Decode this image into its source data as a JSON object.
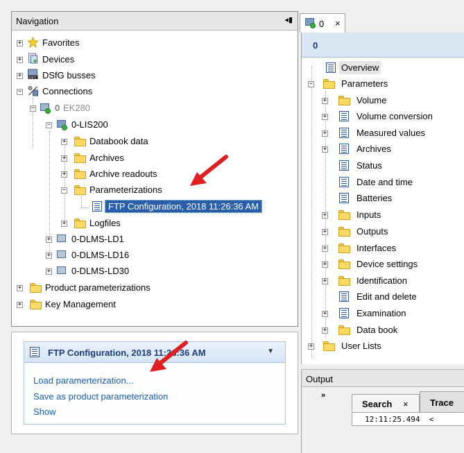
{
  "navigation": {
    "title": "Navigation",
    "pin_icon": "◂▮",
    "tree": {
      "favorites": "Favorites",
      "devices": "Devices",
      "dsfg_busses": "DSfG busses",
      "connections": "Connections",
      "conn_id": "0",
      "conn_device": "EK280",
      "lis200": "0-LIS200",
      "databook": "Databook data",
      "archives": "Archives",
      "archive_readouts": "Archive readouts",
      "parameterizations": "Parameterizations",
      "ftp_config": "FTP Configuration, 2018 11:26:36 AM",
      "logfiles": "Logfiles",
      "dlms_ld1": "0-DLMS-LD1",
      "dlms_ld16": "0-DLMS-LD16",
      "dlms_ld30": "0-DLMS-LD30",
      "product_param": "Product parameterizations",
      "key_mgmt": "Key Management"
    }
  },
  "task_panel": {
    "title": "FTP Configuration, 2018 11:26:36 AM",
    "links": [
      "Load paramerterization...",
      "Save as product parameterization",
      "Show"
    ]
  },
  "right_panel": {
    "tab_label": "0",
    "tab_close": "×",
    "header_label": "0",
    "tree": {
      "overview": "Overview",
      "parameters": "Parameters",
      "volume": "Volume",
      "volume_conversion": "Volume conversion",
      "measured_values": "Measured values",
      "archives": "Archives",
      "status": "Status",
      "date_time": "Date and time",
      "batteries": "Batteries",
      "inputs": "Inputs",
      "outputs": "Outputs",
      "interfaces": "Interfaces",
      "device_settings": "Device settings",
      "identification": "Identification",
      "edit_delete": "Edit and delete",
      "examination": "Examination",
      "data_book": "Data book",
      "user_lists": "User Lists"
    }
  },
  "output": {
    "title": "Output",
    "more": "»",
    "tabs": [
      {
        "label": "Search",
        "close": "×"
      },
      {
        "label": "Trace"
      }
    ],
    "log_line": "12:11:25.494  <"
  },
  "colors": {
    "selection": "#2a5eaa",
    "link": "#1a5fb4",
    "arrow": "#e02020"
  }
}
